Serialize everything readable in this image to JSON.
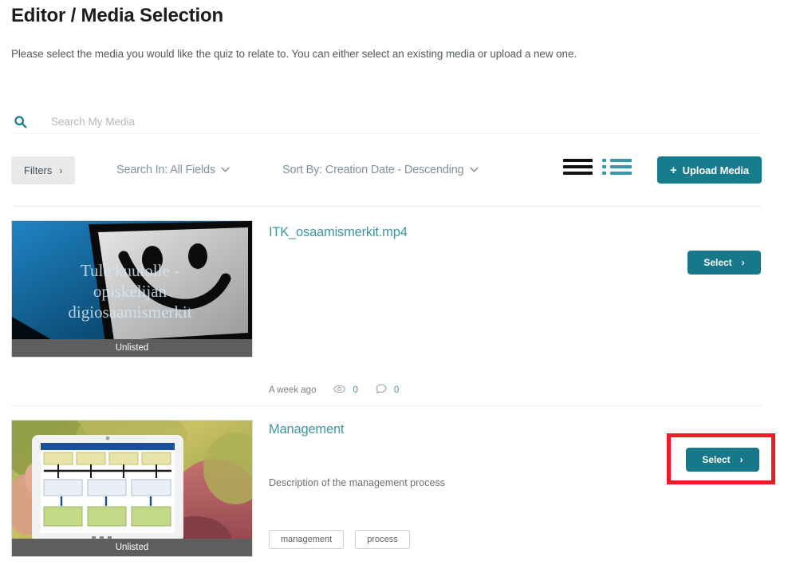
{
  "header": {
    "title": "Editor / Media Selection",
    "subtitle": "Please select the media you would like the quiz to relate to. You can either select an existing media or upload a new one."
  },
  "search": {
    "icon": "search-icon",
    "placeholder": "Search My Media",
    "value": ""
  },
  "toolbar": {
    "filters_label": "Filters",
    "filters_chevron": "›",
    "search_in_label": "Search In: All Fields",
    "sort_by_label": "Sort By: Creation Date - Descending",
    "caret": "⌄",
    "grid_view_icon": "grid-view-icon",
    "list_view_icon": "detail-view-icon",
    "upload_label": "Upload Media",
    "upload_plus": "+",
    "accent_color": "#167b8b",
    "active_view": "list"
  },
  "media_items": [
    {
      "title": "ITK_osaamismerkit.mp4",
      "description": "",
      "privacy_badge": "Unlisted",
      "thumbnail_alt": "Tule kuulolle - opiskelijan digiosaamismerkit",
      "thumbnail_text": "Tule kuulolle -\nopiskelijan\ndigiosaamismerkit",
      "created": "A week ago",
      "views": "0",
      "comments": "0",
      "tags": [],
      "select_label": "Select",
      "select_chevron": "›",
      "highlighted": false
    },
    {
      "title": "Management",
      "description": "Description of the management process",
      "privacy_badge": "Unlisted",
      "thumbnail_alt": "Hand holding a tablet showing a process diagram outdoors",
      "thumbnail_text": "",
      "created": "",
      "views": "",
      "comments": "",
      "tags": [
        "management",
        "process"
      ],
      "select_label": "Select",
      "select_chevron": "›",
      "highlighted": true
    }
  ],
  "highlight": {
    "color": "#ee1c28"
  }
}
